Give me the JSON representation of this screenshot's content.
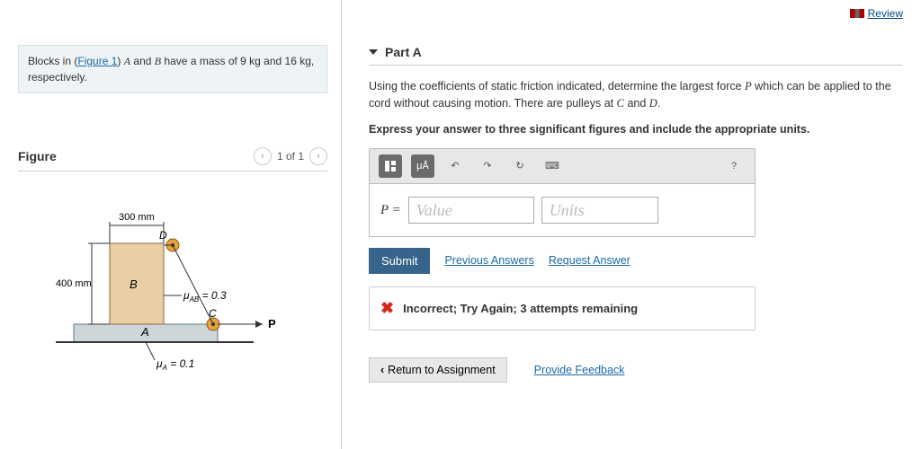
{
  "topbar": {
    "review": "Review"
  },
  "intro": {
    "prefix": "Blocks in (",
    "figlink": "Figure 1",
    "mid": ") ",
    "blockA": "A",
    "and": " and ",
    "blockB": "B",
    "massline": " have a mass of 9 kg and 16 kg, respectively."
  },
  "figure": {
    "title": "Figure",
    "counter": "1 of 1",
    "prev_glyph": "‹",
    "next_glyph": "›",
    "labels": {
      "dim_top": "300 mm",
      "dim_left": "400 mm",
      "D": "D",
      "B": "B",
      "A": "A",
      "C": "C",
      "P": "P",
      "muAB": "μ",
      "muAB_sub": "AB",
      "muAB_val": " = 0.3",
      "muA": "μ",
      "muA_sub": "A",
      "muA_val": " = 0.1"
    }
  },
  "part": {
    "title": "Part A",
    "prompt_1": "Using the coefficients of static friction indicated, determine the largest force ",
    "P": "P",
    "prompt_2": " which can be applied to the cord without causing motion. There are pulleys at ",
    "C": "C",
    "prompt_and": " and ",
    "D": "D",
    "prompt_end": ".",
    "instruct": "Express your answer to three significant figures and include the appropriate units.",
    "toolbar": {
      "mu": "μÅ",
      "undo": "↶",
      "redo": "↷",
      "reset": "↻",
      "kbd": "⌨",
      "help": "?"
    },
    "pequals": "P = ",
    "value_ph": "Value",
    "units_ph": "Units",
    "submit": "Submit",
    "prev_answers": "Previous Answers",
    "request_answer": "Request Answer",
    "feedback": "Incorrect; Try Again; 3 attempts remaining"
  },
  "footer": {
    "return": "Return to Assignment",
    "return_glyph": "‹",
    "provide": "Provide Feedback"
  }
}
